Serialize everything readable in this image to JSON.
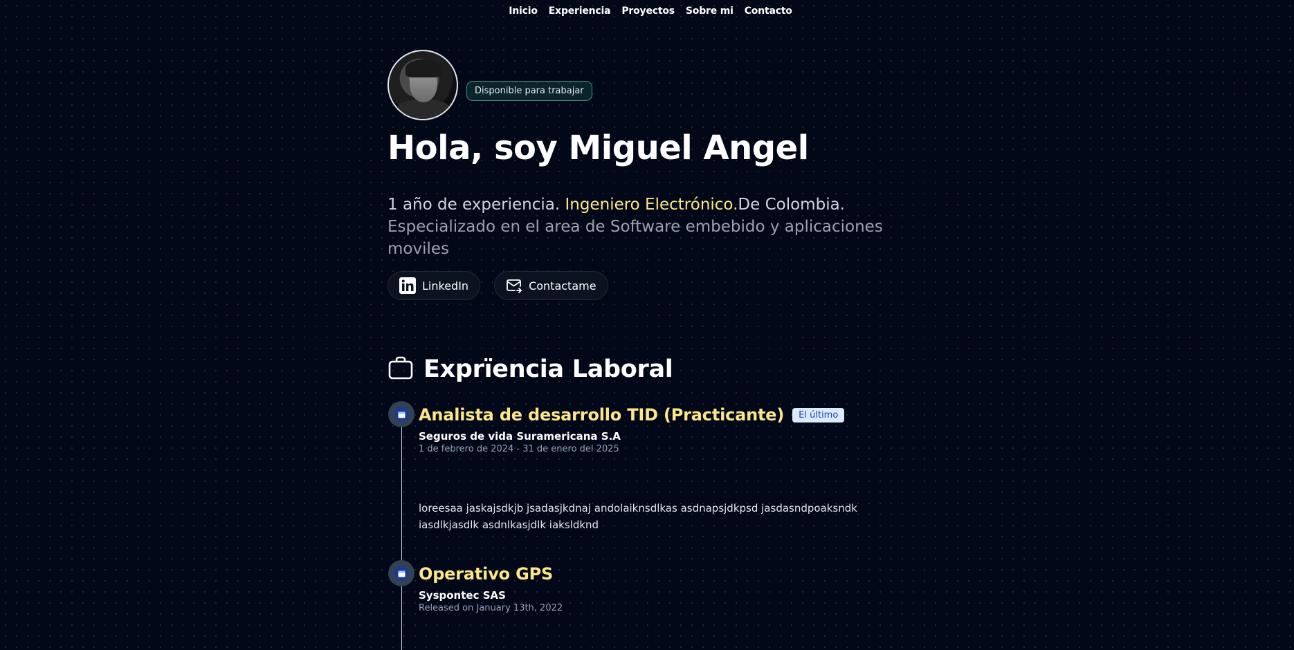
{
  "nav": {
    "items": [
      "Inicio",
      "Experiencia",
      "Proyectos",
      "Sobre mi",
      "Contacto"
    ]
  },
  "hero": {
    "badge": "Disponible para trabajar",
    "title": "Hola, soy Miguel Angel",
    "desc_part1": "1 año de experiencia. ",
    "desc_highlight": "Ingeniero Electrónico.",
    "desc_part2": "De Colombia.",
    "desc_part3": "Especializado en el area de Software embebido y aplicaciones moviles",
    "buttons": {
      "linkedin": "LinkedIn",
      "contact": "Contactame"
    }
  },
  "experience": {
    "title": "Exprïencia Laboral",
    "jobs": [
      {
        "title": "Analista de desarrollo TID (Practicante)",
        "badge": "El último",
        "company": "Seguros de vida Suramericana S.A",
        "date": "1 de febrero de 2024 - 31 de enero del 2025",
        "description": "loreesaa jaskajsdkjb jsadasjkdnaj andolaiknsdlkas asdnapsjdkpsd jasdasndpoaksndk iasdlkjasdlk asdnlkasjdlk iaksldknd"
      },
      {
        "title": "Operativo GPS",
        "company": "Syspontec SAS",
        "date": "Released on January 13th, 2022"
      }
    ]
  },
  "colors": {
    "background": "#020817",
    "accent_yellow": "#fde68a",
    "badge_border": "#3b8f83"
  }
}
